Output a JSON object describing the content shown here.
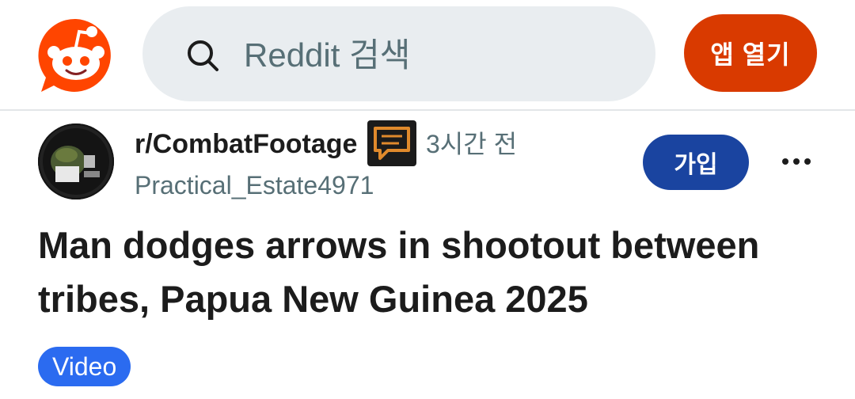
{
  "header": {
    "search_placeholder": "Reddit 검색",
    "open_app_label": "앱 열기"
  },
  "post": {
    "community": "r/CombatFootage",
    "time": "3시간 전",
    "author": "Practical_Estate4971",
    "join_label": "가입",
    "title": "Man dodges arrows in shootout between tribes, Papua New Guinea 2025",
    "flair": "Video"
  },
  "colors": {
    "brand": "#ff4500",
    "open_app_bg": "#d93a00",
    "join_bg": "#1a44a0",
    "flair_bg": "#2b6bf0",
    "search_bg": "#e9edf0"
  },
  "icons": {
    "logo": "reddit-snoo-icon",
    "search": "search-icon",
    "flair": "chat-bubble-icon",
    "more": "more-horizontal-icon"
  }
}
